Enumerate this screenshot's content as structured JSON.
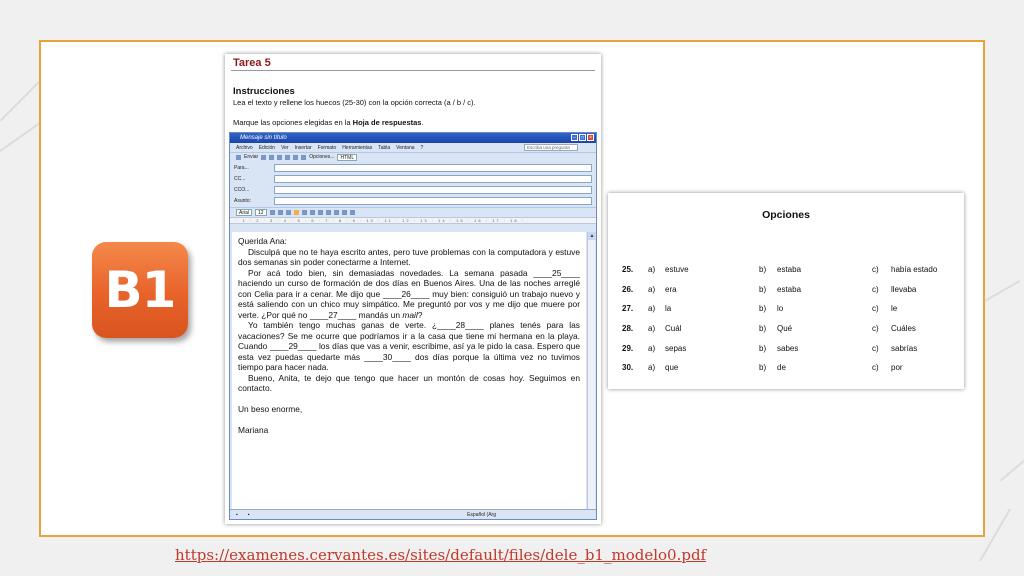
{
  "badge": {
    "label": "B1",
    "color": "#e8622a"
  },
  "frame_color": "#e8a33d",
  "doc": {
    "tarea": "Tarea 5",
    "instrucciones_heading": "Instrucciones",
    "instrucciones_text": "Lea el texto y rellene los huecos (25-30) con la opción correcta (a / b / c).",
    "marque_prefix": "Marque las opciones elegidas en la ",
    "marque_bold": "Hoja de respuestas",
    "marque_suffix": "."
  },
  "window": {
    "title": "Mensaje sin título",
    "menu": [
      "Archivo",
      "Edición",
      "Ver",
      "Insertar",
      "Formato",
      "Herramientas",
      "Tabla",
      "Ventana",
      "?"
    ],
    "help_placeholder": "Escriba una pregunta",
    "toolbar": {
      "send": "Enviar",
      "options": "Opciones...",
      "format": "HTML"
    },
    "fields": {
      "para": "Para...",
      "cc": "CC...",
      "cco": "CCO...",
      "asunto": "Asunto:"
    },
    "font": {
      "name": "Arial",
      "size": "12"
    },
    "ruler": "· 1 · 2 · 3 · 4 · 5 · 6 · 7 · 8 · 9 · 10 · 11 · 12 · 13 · 14 · 15 · 16 · 17 · 18 ·",
    "status_lang": "Español (Arg",
    "email": {
      "greeting": "Querida Ana:",
      "p1": "Disculpá que no te haya escrito antes, pero tuve problemas con la computadora y estuve dos semanas sin poder conectarme a Internet.",
      "p2a": "Por acá todo bien, sin demasiadas novedades. La semana pasada ____25____ haciendo un curso de formación de dos días en Buenos Aires. Una de las noches arreglé con Celia para ir a cenar. Me dijo que ____26____ muy bien: consiguió un trabajo nuevo y está saliendo con un chico muy simpático. Me preguntó por vos y me dijo que muere por verte. ¿Por qué no ____27____ mandás un ",
      "p2_mail": "mail",
      "p2b": "?",
      "p3": "Yo también tengo muchas ganas de verte. ¿____28____ planes tenés para las vacaciones? Se me ocurre que podríamos ir a la casa que tiene mi hermana en la playa. Cuando ____29____ los días que vas a venir, escribime, así ya le pido la casa. Espero que esta vez puedas quedarte más ____30____ dos días porque la última vez no tuvimos tiempo para hacer nada.",
      "p4": "Bueno, Anita, te dejo que tengo que hacer un montón de cosas hoy. Seguimos en contacto.",
      "closing": "Un beso enorme,",
      "signature": "Mariana"
    }
  },
  "opciones": {
    "title": "Opciones",
    "rows": [
      {
        "num": "25.",
        "a": "a)",
        "a_text": "estuve",
        "b": "b)",
        "b_text": "estaba",
        "c": "c)",
        "c_text": "había estado"
      },
      {
        "num": "26.",
        "a": "a)",
        "a_text": "era",
        "b": "b)",
        "b_text": "estaba",
        "c": "c)",
        "c_text": "llevaba"
      },
      {
        "num": "27.",
        "a": "a)",
        "a_text": "la",
        "b": "b)",
        "b_text": "lo",
        "c": "c)",
        "c_text": "le"
      },
      {
        "num": "28.",
        "a": "a)",
        "a_text": "Cuál",
        "b": "b)",
        "b_text": "Qué",
        "c": "c)",
        "c_text": "Cuáles"
      },
      {
        "num": "29.",
        "a": "a)",
        "a_text": "sepas",
        "b": "b)",
        "b_text": "sabes",
        "c": "c)",
        "c_text": "sabrías"
      },
      {
        "num": "30.",
        "a": "a)",
        "a_text": "que",
        "b": "b)",
        "b_text": "de",
        "c": "c)",
        "c_text": "por"
      }
    ]
  },
  "link": {
    "text": "https://examenes.cervantes.es/sites/default/files/dele_b1_modelo0.pdf"
  }
}
